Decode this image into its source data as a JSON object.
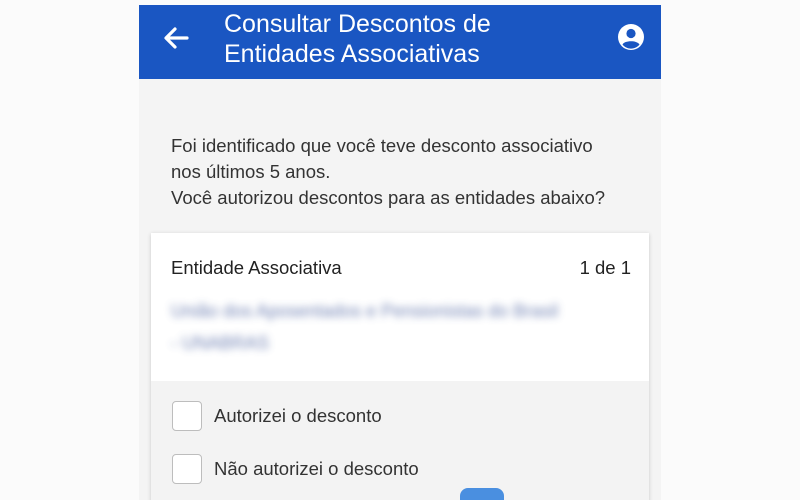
{
  "header": {
    "title_line1": "Consultar Descontos de",
    "title_line2": "Entidades Associativas",
    "back_icon": "arrow-left-icon",
    "account_icon": "account-circle-icon",
    "background_color": "#1a56c2"
  },
  "intro": {
    "line1": "Foi identificado que você teve desconto associativo",
    "line2": "nos últimos 5 anos.",
    "line3": "Você autorizou descontos para as entidades abaixo?"
  },
  "card": {
    "label": "Entidade Associativa",
    "counter": "1 de 1",
    "entity_name_line1": "União dos Aposentados e Pensionistas do Brasil",
    "entity_name_line2": "- UNABRAS"
  },
  "options": [
    {
      "label": "Autorizei o desconto",
      "checked": false
    },
    {
      "label": "Não autorizei o desconto",
      "checked": false
    }
  ]
}
